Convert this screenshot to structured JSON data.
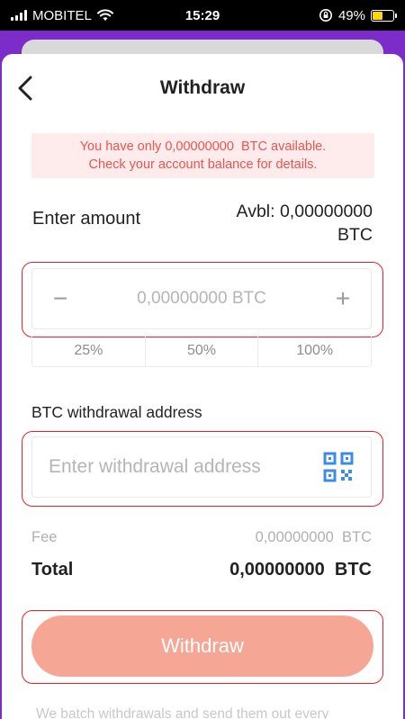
{
  "status_bar": {
    "carrier": "MOBITEL",
    "time": "15:29",
    "battery": "49%",
    "battery_level": 0.49
  },
  "nav": {
    "title": "Withdraw"
  },
  "alert": {
    "line1": "You have only 0,00000000  BTC available.",
    "line2": "Check your account balance for details."
  },
  "amount": {
    "label": "Enter amount",
    "avbl_line1": "Avbl: 0,00000000",
    "avbl_line2": "BTC",
    "minus": "−",
    "plus": "+",
    "placeholder": "0,00000000 BTC",
    "percents": [
      "25%",
      "50%",
      "100%"
    ]
  },
  "address": {
    "label": "BTC withdrawal address",
    "placeholder": "Enter withdrawal address"
  },
  "fee": {
    "label": "Fee",
    "value": "0,00000000  BTC"
  },
  "total": {
    "label": "Total",
    "value": "0,00000000  BTC"
  },
  "withdraw_button": {
    "label": "Withdraw"
  },
  "footnote": "We batch withdrawals and send them out every",
  "colors": {
    "accent": "#f6a694",
    "alert_text": "#ea5450",
    "alert_bg": "#fdeceb",
    "highlight": "#e5222b",
    "frame": "#7b2cc9"
  }
}
